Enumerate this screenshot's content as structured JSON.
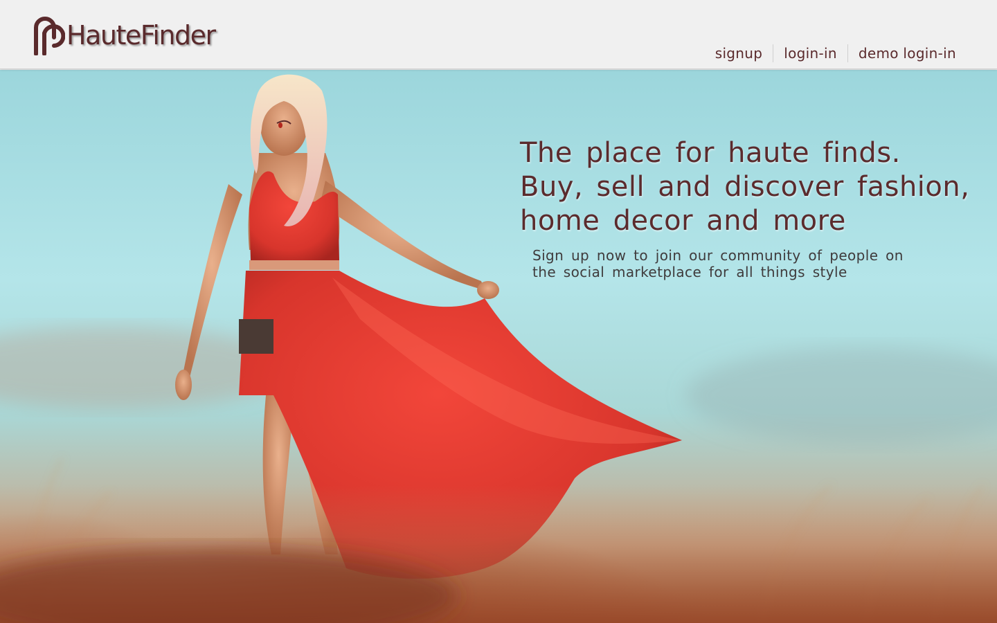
{
  "header": {
    "brand": "HauteFinder",
    "logo_icon": "hautefinder-logo-icon",
    "nav": [
      {
        "label": "signup"
      },
      {
        "label": "login-in"
      },
      {
        "label": "demo login-in"
      }
    ]
  },
  "hero": {
    "tagline": [
      "The place for haute finds.",
      "Buy, sell and discover fashion,",
      "home decor and more"
    ],
    "subtext": [
      "Sign up now to join our community of people on",
      "the social marketplace for all things style"
    ]
  },
  "colors": {
    "brand": "#5a2a2c",
    "header_bg": "#f0f0f0",
    "dress_red": "#e23a32",
    "sky": "#b4e5e9"
  }
}
